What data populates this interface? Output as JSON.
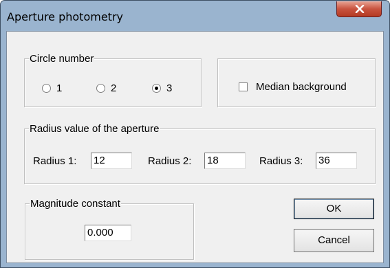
{
  "window": {
    "title": "Aperture photometry"
  },
  "circle_number": {
    "label": "Circle number",
    "options": [
      "1",
      "2",
      "3"
    ],
    "selected": "3"
  },
  "median_background": {
    "label": "Median background",
    "checked": false
  },
  "radius": {
    "label": "Radius value of the aperture",
    "r1": {
      "label": "Radius 1:",
      "value": "12"
    },
    "r2": {
      "label": "Radius 2:",
      "value": "18"
    },
    "r3": {
      "label": "Radius 3:",
      "value": "36"
    }
  },
  "magnitude": {
    "label": "Magnitude constant",
    "value": "0.000"
  },
  "buttons": {
    "ok": "OK",
    "cancel": "Cancel"
  },
  "icons": {
    "close": "close-icon"
  }
}
